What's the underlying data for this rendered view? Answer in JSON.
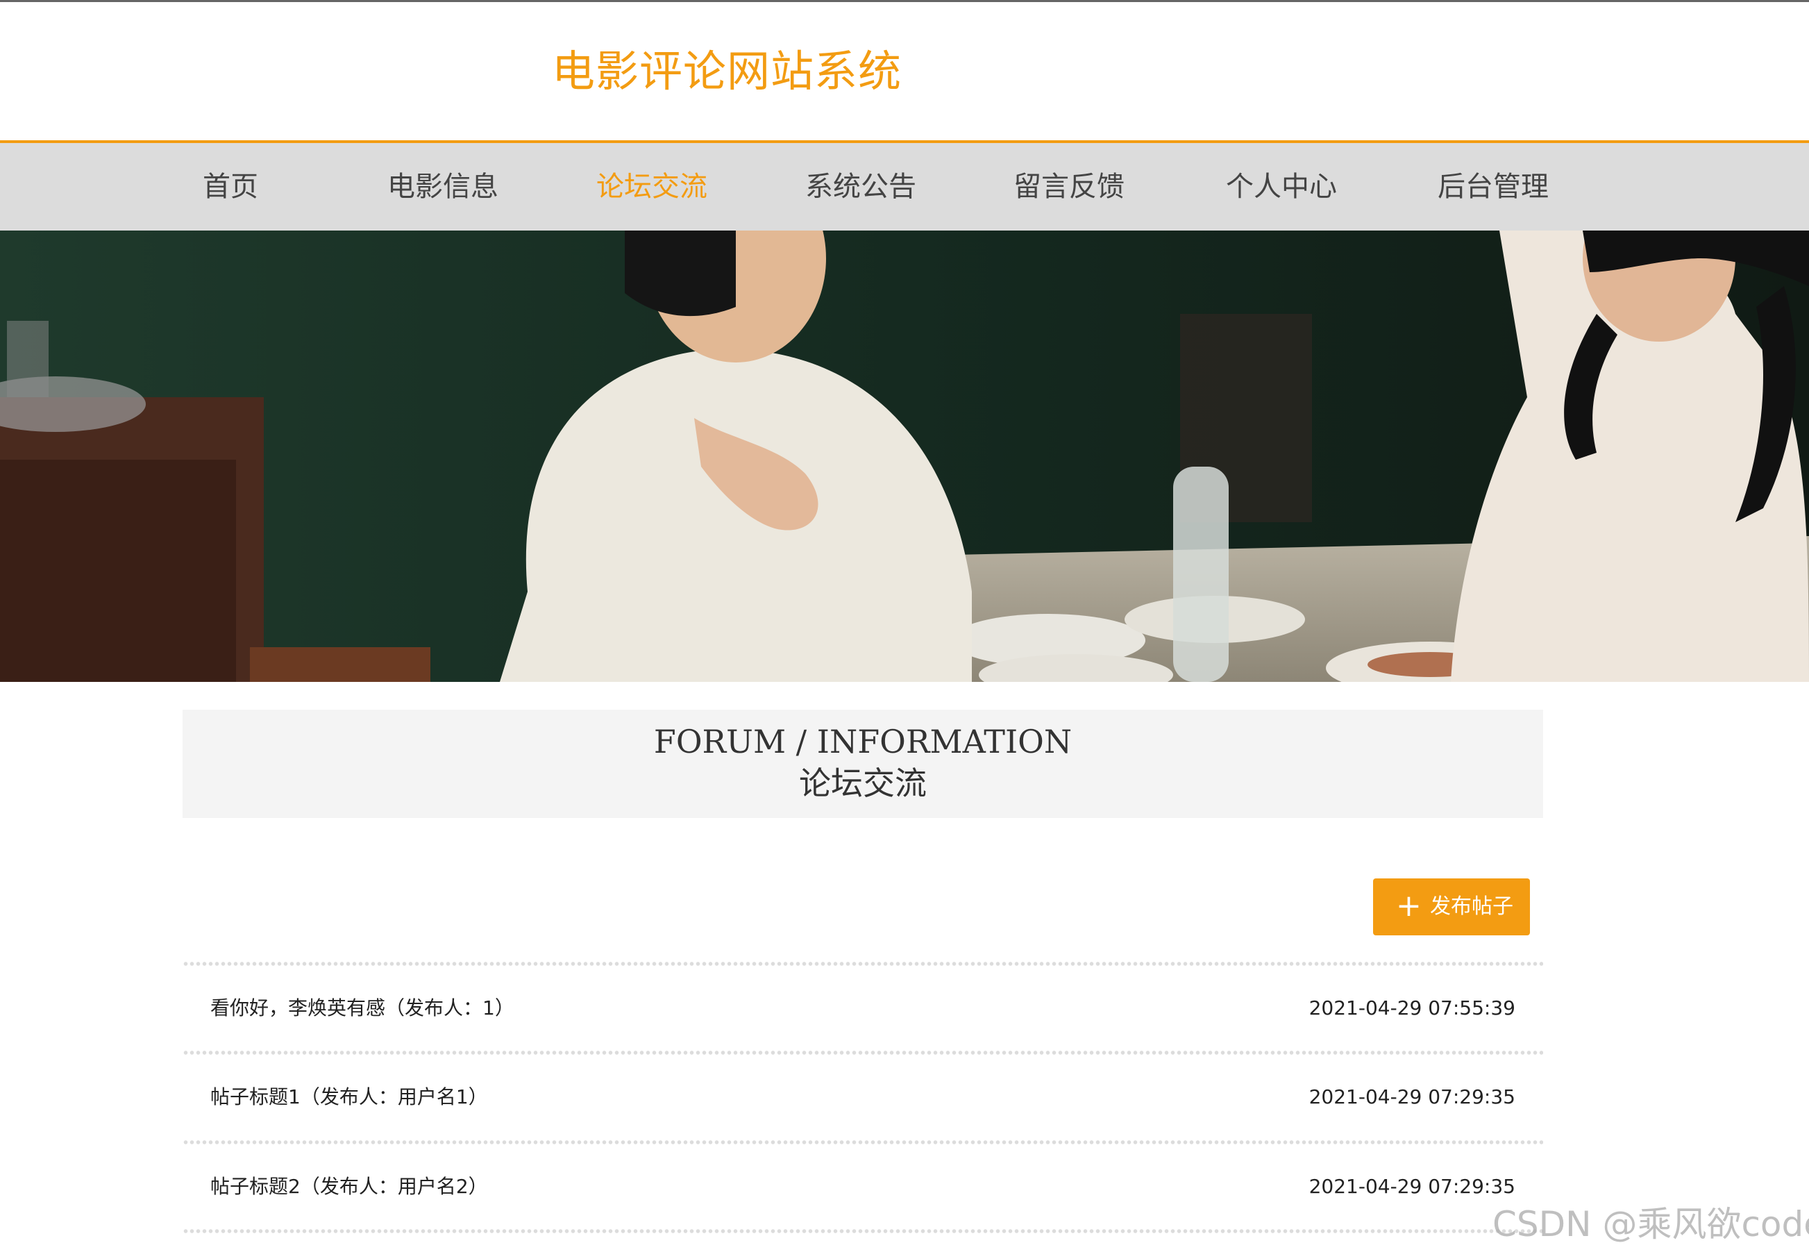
{
  "site": {
    "title": "电影评论网站系统"
  },
  "nav": {
    "items": [
      {
        "label": "首页"
      },
      {
        "label": "电影信息"
      },
      {
        "label": "论坛交流"
      },
      {
        "label": "系统公告"
      },
      {
        "label": "留言反馈"
      },
      {
        "label": "个人中心"
      },
      {
        "label": "后台管理"
      }
    ],
    "active_label": "论坛交流"
  },
  "banner": {
    "slide_count": 3,
    "active_slide": 1
  },
  "section": {
    "title_en": "FORUM / INFORMATION",
    "title_cn": "论坛交流"
  },
  "actions": {
    "publish_icon": "+",
    "publish_label": "发布帖子"
  },
  "posts": [
    {
      "title": "看你好，李焕英有感（发布人：1）",
      "time": "2021-04-29 07:55:39"
    },
    {
      "title": "帖子标题1（发布人：用户名1）",
      "time": "2021-04-29 07:29:35"
    },
    {
      "title": "帖子标题2（发布人：用户名2）",
      "time": "2021-04-29 07:29:35"
    }
  ],
  "watermark": {
    "text": "CSDN @乘风欲code"
  },
  "colors": {
    "accent": "#f39c12",
    "nav_background": "#dcdcdc",
    "section_background": "#f4f4f4"
  }
}
